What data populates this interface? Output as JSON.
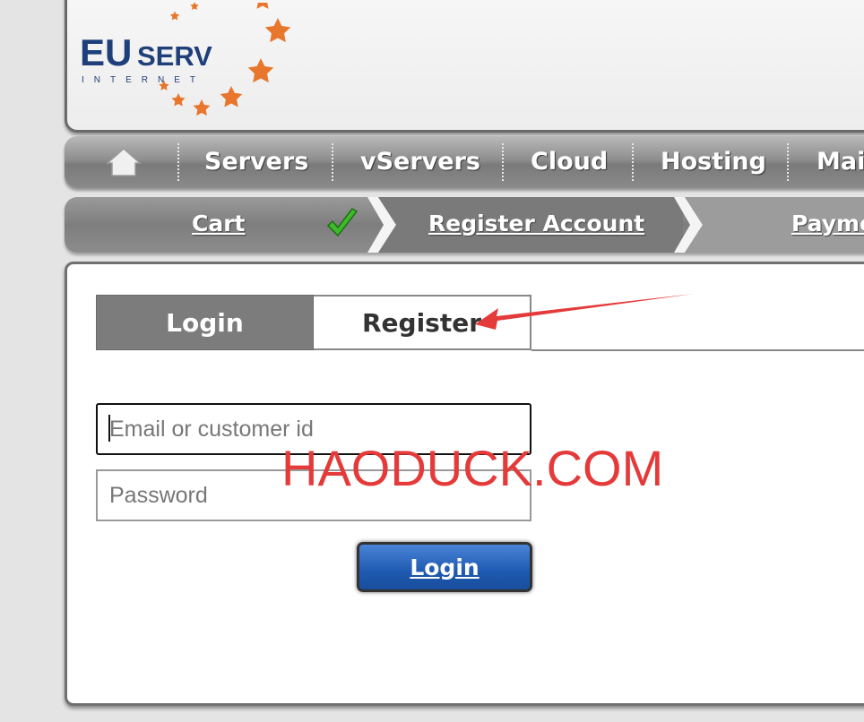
{
  "brand": {
    "logo_text_main": "EUSERV",
    "logo_text_sub": "INTERNET"
  },
  "nav": {
    "home_icon": "home-icon",
    "items": [
      {
        "label": "Servers"
      },
      {
        "label": "vServers"
      },
      {
        "label": "Cloud"
      },
      {
        "label": "Hosting"
      },
      {
        "label": "Mai"
      }
    ]
  },
  "steps": {
    "items": [
      {
        "label": "Cart",
        "state": "completed",
        "icon": "check-icon"
      },
      {
        "label": "Register Account",
        "state": "current"
      },
      {
        "label": "Payme",
        "state": "upcoming"
      }
    ]
  },
  "auth": {
    "tabs": [
      {
        "label": "Login",
        "active": true
      },
      {
        "label": "Register",
        "active": false
      }
    ],
    "email_placeholder": "Email or customer id",
    "email_value": "",
    "password_placeholder": "Password",
    "password_value": "",
    "submit_label": "Login"
  },
  "annotation": {
    "watermark": "HAODUCK.COM",
    "arrow_color": "#e53a3a"
  },
  "colors": {
    "star": "#e8762c",
    "logo_blue": "#1e3f7a",
    "button_blue": "#1e5ab1",
    "tab_active_bg": "#7c7c7c"
  }
}
